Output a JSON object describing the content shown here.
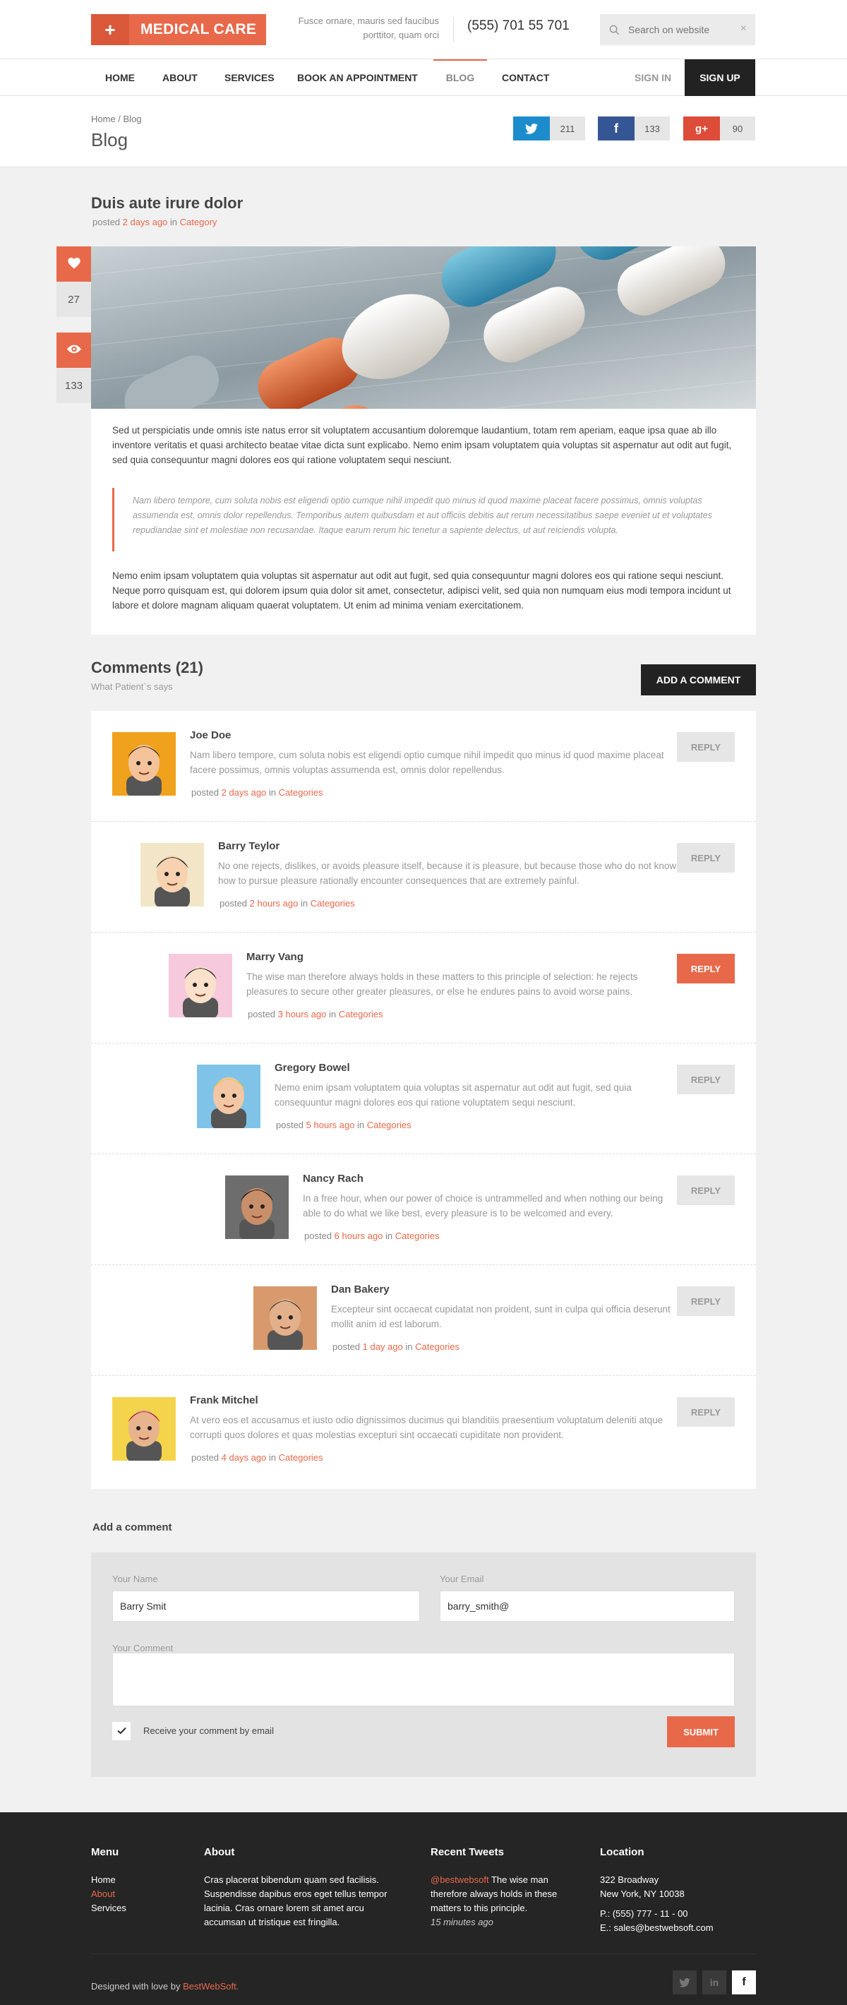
{
  "header": {
    "logo_plus": "+",
    "logo_text": "MEDICAL CARE",
    "tagline": "Fusce ornare, mauris sed faucibus porttitor, quam orci",
    "phone": "(555) 701 55 701",
    "search_placeholder": "Search on website",
    "search_clear": "×"
  },
  "nav": {
    "items": [
      "HOME",
      "ABOUT",
      "SERVICES",
      "BOOK AN APPOINTMENT",
      "BLOG",
      "CONTACT"
    ],
    "active": "BLOG",
    "sign_in": "SIGN IN",
    "sign_up": "SIGN UP"
  },
  "page_title": {
    "breadcrumb": "Home / Blog",
    "title": "Blog",
    "shares": [
      {
        "network": "twitter-icon",
        "count": "211",
        "color": "#1d8ccd"
      },
      {
        "network": "facebook-icon",
        "count": "133",
        "color": "#355694"
      },
      {
        "network": "google-plus-icon",
        "count": "90",
        "color": "#dd4b39"
      }
    ]
  },
  "post": {
    "title": "Duis aute irure dolor",
    "meta_prefix": "posted",
    "meta_time": "2 days ago",
    "meta_in": "in",
    "meta_category": "Category",
    "likes": "27",
    "views": "133",
    "para1": "Sed ut perspiciatis unde omnis iste natus error sit voluptatem accusantium doloremque laudantium, totam rem aperiam, eaque ipsa quae ab illo inventore veritatis et quasi architecto beatae vitae dicta sunt explicabo. Nemo enim ipsam voluptatem quia voluptas sit aspernatur aut odit aut fugit, sed quia consequuntur magni dolores eos qui ratione voluptatem sequi nesciunt.",
    "quote": "Nam libero tempore, cum soluta nobis est eligendi optio cumque nihil impedit quo minus id quod maxime placeat facere possimus, omnis voluptas assumenda est, omnis dolor repellendus. Temporibus autem quibusdam et aut officiis debitis aut rerum necessitatibus saepe eveniet ut et voluptates repudiandae sint et molestiae non recusandae. Itaque earum rerum hic tenetur a sapiente delectus, ut aut reiciendis volupta.",
    "para2": "Nemo enim ipsam voluptatem quia voluptas sit aspernatur aut odit aut fugit, sed quia consequuntur magni dolores eos qui ratione sequi nesciunt. Neque porro quisquam est, qui dolorem ipsum quia dolor sit amet, consectetur, adipisci velit, sed quia non numquam eius modi tempora incidunt ut labore et dolore magnam aliquam quaerat voluptatem. Ut enim ad minima veniam exercitationem."
  },
  "comments": {
    "title": "Comments (21)",
    "subtitle": "What Patient`s says",
    "add_button": "ADD A COMMENT",
    "posted": "posted",
    "in": "in",
    "reply": "REPLY",
    "items": [
      {
        "name": "Joe Doe",
        "text": "Nam libero tempore, cum soluta nobis est eligendi optio cumque nihil impedit quo minus id quod maxime placeat facere possimus, omnis voluptas assumenda est, omnis dolor repellendus.",
        "time": "2 days ago",
        "category": "Categories",
        "reply_active": false,
        "avatar_bg": "#f0a21c"
      },
      {
        "name": "Barry Teylor",
        "text": "No one rejects, dislikes, or avoids pleasure itself, because it is pleasure, but because those who do not know how to pursue pleasure rationally encounter consequences that are extremely painful.",
        "time": "2 hours ago",
        "category": "Categories",
        "reply_active": false,
        "avatar_bg": "#f3e6c8"
      },
      {
        "name": "Marry Vang",
        "text": "The wise man therefore always holds in these matters to this principle of selection: he rejects pleasures to secure other greater pleasures, or else he endures pains to avoid worse pains.",
        "time": "3 hours ago",
        "category": "Categories",
        "reply_active": true,
        "avatar_bg": "#f7c9dc"
      },
      {
        "name": "Gregory Bowel",
        "text": "Nemo enim ipsam voluptatem quia voluptas sit aspernatur aut odit aut fugit, sed quia consequuntur magni dolores eos qui ratione voluptatem sequi nesciunt.",
        "time": "5 hours ago",
        "category": "Categories",
        "reply_active": false,
        "avatar_bg": "#7fc3e8"
      },
      {
        "name": "Nancy Rach",
        "text": "In a free hour, when our power of choice is untrammelled and when nothing our being able to do what we like best, every pleasure is to be welcomed and every.",
        "time": "6 hours ago",
        "category": "Categories",
        "reply_active": false,
        "avatar_bg": "#6d6d6d"
      },
      {
        "name": "Dan Bakery",
        "text": "Excepteur sint occaecat cupidatat non proident, sunt in culpa qui officia deserunt mollit anim id est laborum.",
        "time": "1 day ago",
        "category": "Categories",
        "reply_active": false,
        "avatar_bg": "#d89a6c"
      },
      {
        "name": "Frank Mitchel",
        "text": "At vero eos et accusamus et iusto odio dignissimos ducimus qui blanditiis praesentium voluptatum deleniti atque corrupti quos dolores et quas molestias excepturi sint occaecati cupiditate non provident.",
        "time": "4 days ago",
        "category": "Categories",
        "reply_active": false,
        "avatar_bg": "#f4d44a"
      }
    ]
  },
  "form": {
    "heading": "Add a comment",
    "name_label": "Your Name",
    "name_value": "Barry Smit",
    "email_label": "Your Email",
    "email_value": "barry_smith@",
    "comment_label": "Your Comment",
    "comment_value": "",
    "checkbox_label": "Receive your comment by email",
    "checkbox_checked": true,
    "submit": "SUBMIT"
  },
  "footer": {
    "menu_title": "Menu",
    "menu_items": [
      "Home",
      "About",
      "Services"
    ],
    "about_title": "About",
    "about_text": "Cras placerat bibendum quam sed facilisis. Suspendisse dapibus eros eget tellus tempor lacinia. Cras ornare lorem sit amet arcu accumsan ut tristique est fringilla.",
    "tweets_title": "Recent Tweets",
    "tweet_handle": "@bestwebsoft",
    "tweet_text": "The wise man therefore always holds in these matters to this principle.",
    "tweet_time": "15 minutes ago",
    "location_title": "Location",
    "address1": "322 Broadway",
    "address2": "New York, NY 10038",
    "phone": "P.: (555) 777 - 11 - 00",
    "email": "E.: sales@bestwebsoft.com",
    "credit_prefix": "Designed with love by",
    "credit_link": "BestWebSoft."
  },
  "colors": {
    "accent": "#e8694a",
    "dark": "#222222",
    "footer": "#252525"
  }
}
